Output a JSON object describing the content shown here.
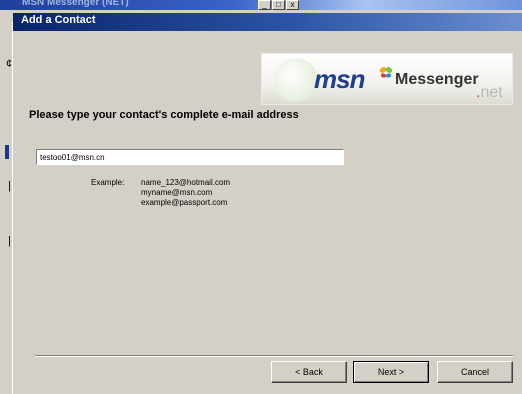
{
  "parent_window": {
    "title": "MSN Messenger (NET)"
  },
  "dialog": {
    "title": "Add a Contact"
  },
  "banner": {
    "msn": "msn",
    "messenger": "Messenger",
    "net_dot": ".",
    "net": "net"
  },
  "form": {
    "heading": "Please type your contact's complete e-mail address",
    "email_value": "testoo01@msn.cn",
    "example_label": "Example:",
    "examples": [
      "name_123@hotmail.com",
      "myname@msn.com",
      "example@passport.com"
    ]
  },
  "buttons": {
    "back": "< Back",
    "next": "Next >",
    "cancel": "Cancel"
  },
  "colors": {
    "title_bar": "#0a246a",
    "window_face": "#d4d0c8",
    "msn_blue": "#1f3f8e"
  }
}
